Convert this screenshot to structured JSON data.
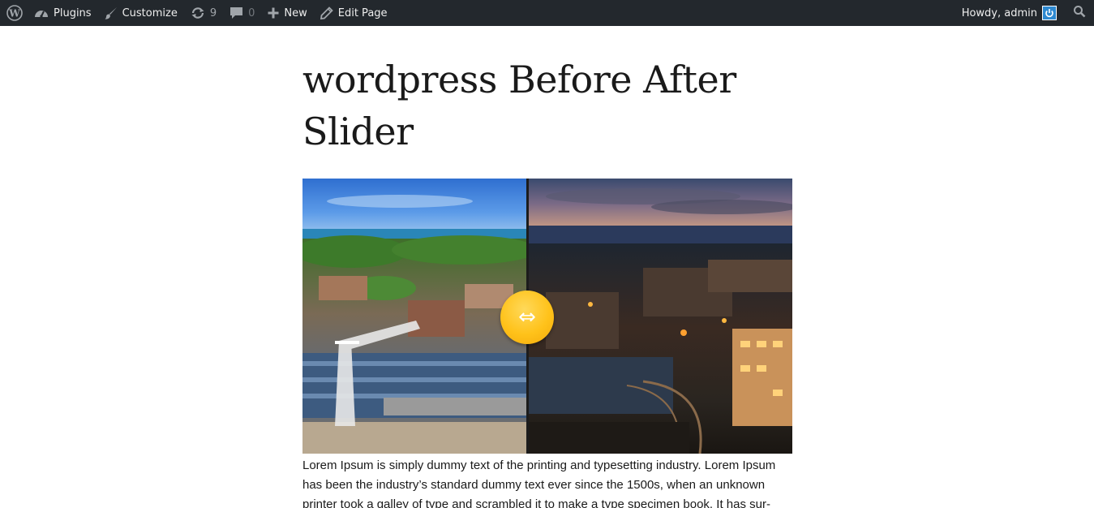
{
  "adminbar": {
    "items": {
      "wp_logo": "wordpress-logo-icon",
      "plugins": "Plugins",
      "customize": "Customize",
      "updates_count": "9",
      "comments_count": "0",
      "new": "New",
      "edit_page": "Edit Page"
    },
    "howdy": "Howdy, admin"
  },
  "page": {
    "title": "wordpress Before After Slider",
    "slider": {
      "handle_glyph": "⇔",
      "divider_fraction": 0.46
    },
    "body_text": "Lorem Ipsum is simply dummy text of the printing and typesetting industry. Lorem Ipsum has been the industry’s standard dummy text ever since the 1500s, when an unknown printer took a galley of type and scrambled it to make a type specimen book. It has sur-"
  },
  "colors": {
    "adminbar_bg": "#23282d",
    "adminbar_text": "#eeeeee",
    "handle": "#ffc21a",
    "avatar": "#2e89d0"
  }
}
